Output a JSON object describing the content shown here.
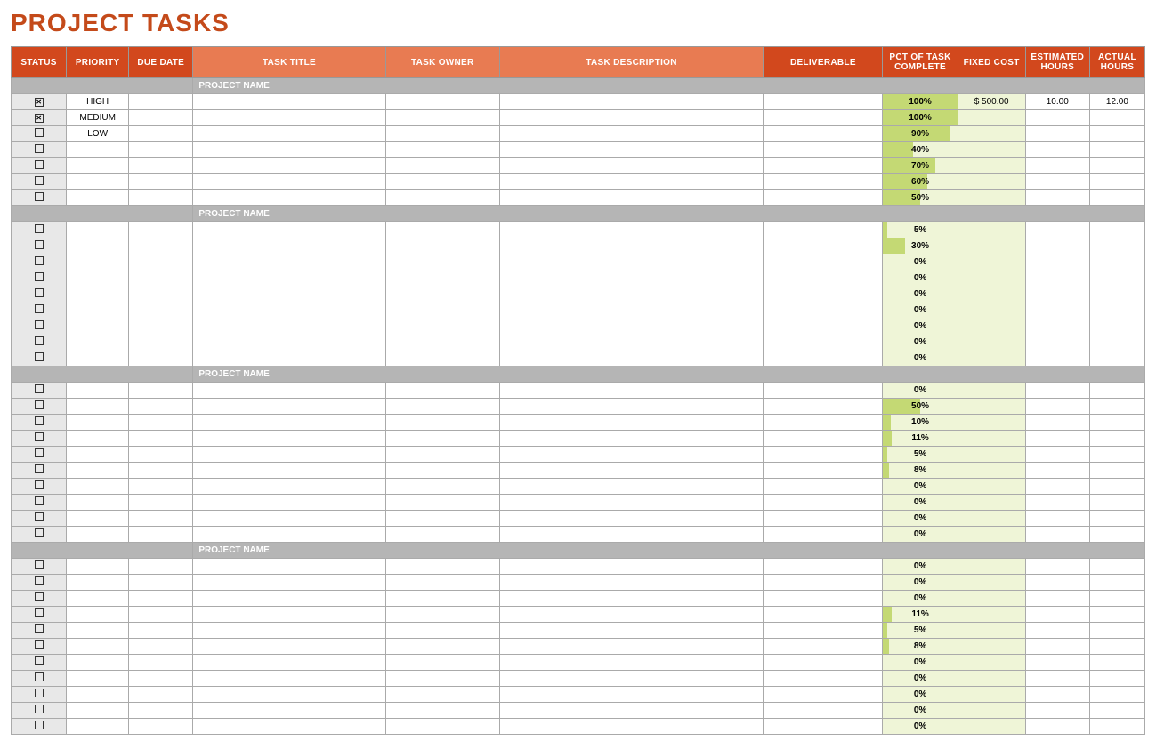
{
  "title": "PROJECT TASKS",
  "headers": {
    "status": "STATUS",
    "priority": "PRIORITY",
    "due_date": "DUE DATE",
    "task_title": "TASK TITLE",
    "task_owner": "TASK OWNER",
    "task_desc": "TASK DESCRIPTION",
    "deliverable": "DELIVERABLE",
    "pct": "PCT OF TASK COMPLETE",
    "fixed_cost": "FIXED COST",
    "est_hours": "ESTIMATED HOURS",
    "act_hours": "ACTUAL HOURS"
  },
  "section_label": "PROJECT NAME",
  "groups": [
    {
      "rows": [
        {
          "checked": true,
          "priority": "HIGH",
          "pct": 100,
          "fixed_cost": "$       500.00",
          "est_hours": "10.00",
          "act_hours": "12.00"
        },
        {
          "checked": true,
          "priority": "MEDIUM",
          "pct": 100
        },
        {
          "checked": false,
          "priority": "LOW",
          "pct": 90
        },
        {
          "checked": false,
          "pct": 40
        },
        {
          "checked": false,
          "pct": 70
        },
        {
          "checked": false,
          "pct": 60
        },
        {
          "checked": false,
          "pct": 50
        }
      ]
    },
    {
      "rows": [
        {
          "checked": false,
          "pct": 5
        },
        {
          "checked": false,
          "pct": 30
        },
        {
          "checked": false,
          "pct": 0
        },
        {
          "checked": false,
          "pct": 0
        },
        {
          "checked": false,
          "pct": 0
        },
        {
          "checked": false,
          "pct": 0
        },
        {
          "checked": false,
          "pct": 0
        },
        {
          "checked": false,
          "pct": 0
        },
        {
          "checked": false,
          "pct": 0
        }
      ]
    },
    {
      "rows": [
        {
          "checked": false,
          "pct": 0
        },
        {
          "checked": false,
          "pct": 50
        },
        {
          "checked": false,
          "pct": 10
        },
        {
          "checked": false,
          "pct": 11
        },
        {
          "checked": false,
          "pct": 5
        },
        {
          "checked": false,
          "pct": 8
        },
        {
          "checked": false,
          "pct": 0
        },
        {
          "checked": false,
          "pct": 0
        },
        {
          "checked": false,
          "pct": 0
        },
        {
          "checked": false,
          "pct": 0
        }
      ]
    },
    {
      "rows": [
        {
          "checked": false,
          "pct": 0
        },
        {
          "checked": false,
          "pct": 0
        },
        {
          "checked": false,
          "pct": 0
        },
        {
          "checked": false,
          "pct": 11
        },
        {
          "checked": false,
          "pct": 5
        },
        {
          "checked": false,
          "pct": 8
        },
        {
          "checked": false,
          "pct": 0
        },
        {
          "checked": false,
          "pct": 0
        },
        {
          "checked": false,
          "pct": 0
        },
        {
          "checked": false,
          "pct": 0
        },
        {
          "checked": false,
          "pct": 0
        }
      ]
    }
  ]
}
